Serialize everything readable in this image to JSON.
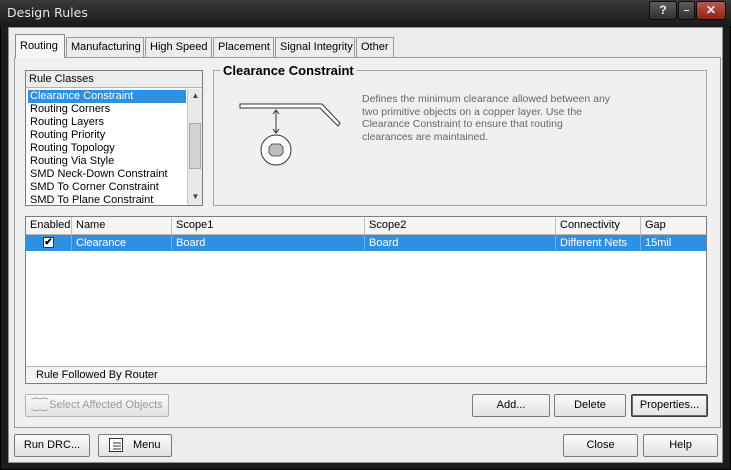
{
  "window": {
    "title": "Design Rules"
  },
  "titlebar_buttons": {
    "help": "?",
    "minimize": "–",
    "close": "✕"
  },
  "tabs": [
    {
      "label": "Routing",
      "accel": ""
    },
    {
      "label": "Manufacturing"
    },
    {
      "label": "High Speed"
    },
    {
      "label": "Placement"
    },
    {
      "label": "Signal Integrity"
    },
    {
      "label": "Other"
    }
  ],
  "rule_classes": {
    "header": "Rule Classes",
    "items": [
      "Clearance Constraint",
      "Routing Corners",
      "Routing Layers",
      "Routing Priority",
      "Routing Topology",
      "Routing Via Style",
      "SMD Neck-Down Constraint",
      "SMD To Corner Constraint",
      "SMD To Plane Constraint"
    ],
    "selected_index": 0
  },
  "constraint": {
    "title": "Clearance Constraint",
    "description": "Defines the minimum clearance allowed between any two primitive objects on a copper layer. Use the Clearance Constraint to ensure that routing clearances are maintained."
  },
  "grid": {
    "columns": [
      "Enabled",
      "Name",
      "Scope1",
      "Scope2",
      "Connectivity",
      "Gap"
    ],
    "rows": [
      {
        "enabled": true,
        "name": "Clearance",
        "scope1": "Board",
        "scope2": "Board",
        "connectivity": "Different Nets",
        "gap": "15mil"
      }
    ],
    "footer": "Rule Followed By Router"
  },
  "buttons": {
    "select_affected": "Select Affected Objects",
    "add": "Add...",
    "delete": "Delete",
    "properties": "Properties...",
    "run_drc": "Run DRC...",
    "menu": "Menu",
    "close": "Close",
    "help": "Help"
  },
  "colors": {
    "selection": "#2f8fe0",
    "panel": "#f0f0f0"
  }
}
